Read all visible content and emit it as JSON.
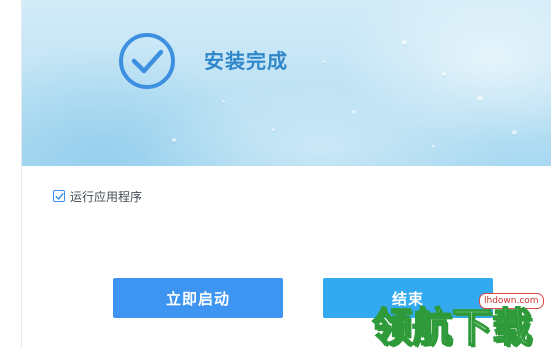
{
  "installer": {
    "title": "安装完成",
    "run_app_checkbox": {
      "label": "运行应用程序",
      "checked": true
    },
    "buttons": {
      "launch_label": "立即启动",
      "finish_label": "结束"
    }
  },
  "watermark": {
    "brand_text": "领航下载",
    "site_badge": "lhdown.com"
  },
  "colors": {
    "accent": "#3d95f1",
    "title_blue": "#2f86c9",
    "finish_button": "#33a9f0",
    "banner_sky": "#c2e4f5"
  },
  "icons": {
    "status": "check-circle-icon",
    "checkbox": "checkmark-icon"
  }
}
